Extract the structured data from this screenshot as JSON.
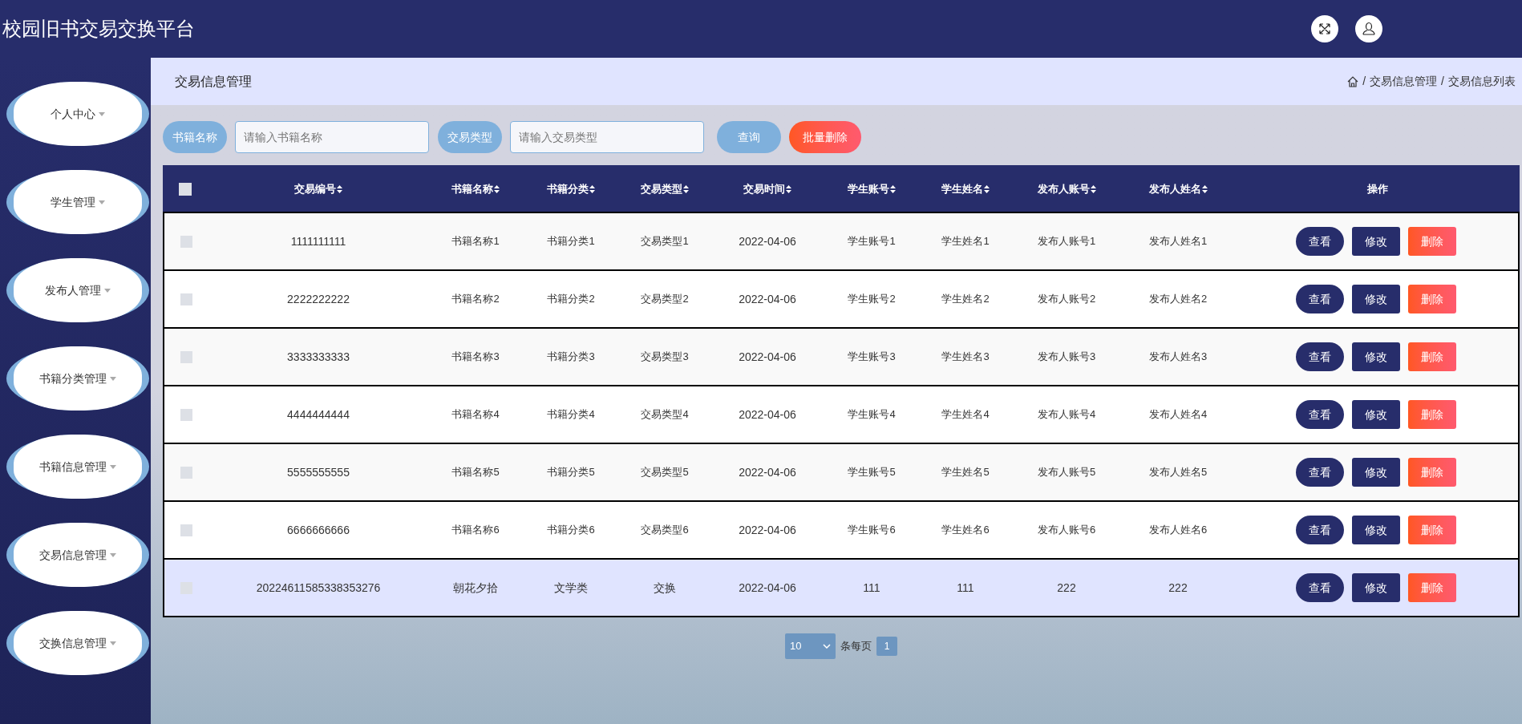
{
  "header": {
    "title": "校园旧书交易交换平台"
  },
  "sidebar": {
    "items": [
      {
        "label": "个人中心"
      },
      {
        "label": "学生管理"
      },
      {
        "label": "发布人管理"
      },
      {
        "label": "书籍分类管理"
      },
      {
        "label": "书籍信息管理"
      },
      {
        "label": "交易信息管理"
      },
      {
        "label": "交换信息管理"
      }
    ]
  },
  "page_title": "交易信息管理",
  "breadcrumb": [
    {
      "separator": "/",
      "label": "交易信息管理"
    },
    {
      "separator": "/",
      "label": "交易信息列表"
    }
  ],
  "search": {
    "fields": [
      {
        "label": "书籍名称",
        "placeholder": "请输入书籍名称"
      },
      {
        "label": "交易类型",
        "placeholder": "请输入交易类型"
      }
    ],
    "buttons": [
      {
        "label": "查询",
        "kind": "query"
      },
      {
        "label": "批量删除",
        "kind": "danger"
      }
    ]
  },
  "table": {
    "select_all_checked": false,
    "columns": [
      {
        "label": "交易编号",
        "sortable": true
      },
      {
        "label": "书籍名称",
        "sortable": true
      },
      {
        "label": "书籍分类",
        "sortable": true
      },
      {
        "label": "交易类型",
        "sortable": true
      },
      {
        "label": "交易时间",
        "sortable": true
      },
      {
        "label": "学生账号",
        "sortable": true
      },
      {
        "label": "学生姓名",
        "sortable": true
      },
      {
        "label": "发布人账号",
        "sortable": true
      },
      {
        "label": "发布人姓名",
        "sortable": true
      },
      {
        "label": "操作",
        "sortable": false
      }
    ],
    "rows": [
      {
        "checked": false,
        "hovered": false,
        "cells": [
          "1111111111",
          "书籍名称1",
          "书籍分类1",
          "交易类型1",
          "2022-04-06",
          "学生账号1",
          "学生姓名1",
          "发布人账号1",
          "发布人姓名1"
        ],
        "actions": [
          {
            "label": "查看",
            "kind": "view"
          },
          {
            "label": "修改",
            "kind": "edit"
          },
          {
            "label": "删除",
            "kind": "delete"
          }
        ]
      },
      {
        "checked": false,
        "hovered": false,
        "cells": [
          "2222222222",
          "书籍名称2",
          "书籍分类2",
          "交易类型2",
          "2022-04-06",
          "学生账号2",
          "学生姓名2",
          "发布人账号2",
          "发布人姓名2"
        ],
        "actions": [
          {
            "label": "查看",
            "kind": "view"
          },
          {
            "label": "修改",
            "kind": "edit"
          },
          {
            "label": "删除",
            "kind": "delete"
          }
        ]
      },
      {
        "checked": false,
        "hovered": false,
        "cells": [
          "3333333333",
          "书籍名称3",
          "书籍分类3",
          "交易类型3",
          "2022-04-06",
          "学生账号3",
          "学生姓名3",
          "发布人账号3",
          "发布人姓名3"
        ],
        "actions": [
          {
            "label": "查看",
            "kind": "view"
          },
          {
            "label": "修改",
            "kind": "edit"
          },
          {
            "label": "删除",
            "kind": "delete"
          }
        ]
      },
      {
        "checked": false,
        "hovered": false,
        "cells": [
          "4444444444",
          "书籍名称4",
          "书籍分类4",
          "交易类型4",
          "2022-04-06",
          "学生账号4",
          "学生姓名4",
          "发布人账号4",
          "发布人姓名4"
        ],
        "actions": [
          {
            "label": "查看",
            "kind": "view"
          },
          {
            "label": "修改",
            "kind": "edit"
          },
          {
            "label": "删除",
            "kind": "delete"
          }
        ]
      },
      {
        "checked": false,
        "hovered": false,
        "cells": [
          "5555555555",
          "书籍名称5",
          "书籍分类5",
          "交易类型5",
          "2022-04-06",
          "学生账号5",
          "学生姓名5",
          "发布人账号5",
          "发布人姓名5"
        ],
        "actions": [
          {
            "label": "查看",
            "kind": "view"
          },
          {
            "label": "修改",
            "kind": "edit"
          },
          {
            "label": "删除",
            "kind": "delete"
          }
        ]
      },
      {
        "checked": false,
        "hovered": false,
        "cells": [
          "6666666666",
          "书籍名称6",
          "书籍分类6",
          "交易类型6",
          "2022-04-06",
          "学生账号6",
          "学生姓名6",
          "发布人账号6",
          "发布人姓名6"
        ],
        "actions": [
          {
            "label": "查看",
            "kind": "view"
          },
          {
            "label": "修改",
            "kind": "edit"
          },
          {
            "label": "删除",
            "kind": "delete"
          }
        ]
      },
      {
        "checked": false,
        "hovered": true,
        "cells": [
          "20224611585338353276",
          "朝花夕拾",
          "文学类",
          "交换",
          "2022-04-06",
          "111",
          "111",
          "222",
          "222"
        ],
        "actions": [
          {
            "label": "查看",
            "kind": "view"
          },
          {
            "label": "修改",
            "kind": "edit"
          },
          {
            "label": "删除",
            "kind": "delete"
          }
        ]
      }
    ]
  },
  "pagination": {
    "page_size": "10",
    "page_size_label": "条每页",
    "pages": [
      {
        "label": "1",
        "selected": true
      }
    ]
  }
}
